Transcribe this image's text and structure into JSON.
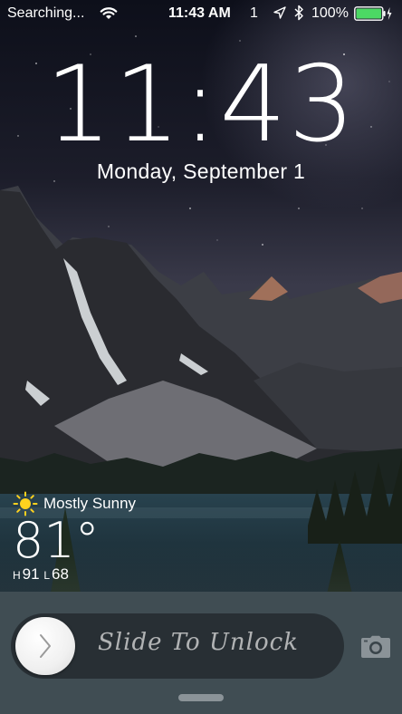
{
  "status_bar": {
    "carrier": "Searching...",
    "time": "11:43 AM",
    "count": "1",
    "battery_percent": "100%",
    "battery_level": 1.0,
    "battery_color": "#4cd964",
    "icons": [
      "wifi-icon",
      "location-arrow-icon",
      "bluetooth-icon",
      "battery-icon",
      "charging-bolt-icon"
    ]
  },
  "lock": {
    "time": "11:43",
    "date": "Monday, September 1"
  },
  "weather": {
    "condition": "Mostly Sunny",
    "temperature": "81°",
    "high_label": "H",
    "high": "91",
    "low_label": "L",
    "low": "68",
    "icon": "sun-icon",
    "sun_color": "#ffd21e"
  },
  "unlock": {
    "label": "Slide To Unlock",
    "knob_icon": "chevron-right-icon"
  },
  "camera": {
    "icon": "camera-icon"
  }
}
